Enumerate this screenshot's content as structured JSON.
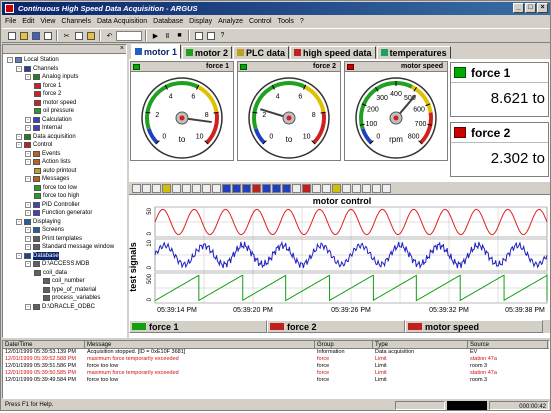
{
  "window": {
    "title": "Continuous High Speed Data Acquisition - ARGUS"
  },
  "menu": [
    "File",
    "Edit",
    "View",
    "Channels",
    "Data Acquisition",
    "Database",
    "Display",
    "Analyze",
    "Control",
    "Tools",
    "?"
  ],
  "tree": [
    {
      "label": "Local Station",
      "depth": 0,
      "icon": "computer-icon",
      "color": "#6080c0"
    },
    {
      "label": "Channels",
      "depth": 1,
      "icon": "folder-icon",
      "color": "#2040a0"
    },
    {
      "label": "Analog inputs",
      "depth": 2,
      "icon": "analog-icon",
      "color": "#208020"
    },
    {
      "label": "force 1",
      "depth": 3,
      "icon": "channel-icon",
      "color": "#d02020"
    },
    {
      "label": "force 2",
      "depth": 3,
      "icon": "channel-icon",
      "color": "#d02020"
    },
    {
      "label": "motor speed",
      "depth": 3,
      "icon": "channel-icon",
      "color": "#d02020"
    },
    {
      "label": "oil pressure",
      "depth": 3,
      "icon": "channel-icon",
      "color": "#20a020"
    },
    {
      "label": "Calculation",
      "depth": 2,
      "icon": "calc-icon",
      "color": "#4040c0"
    },
    {
      "label": "Internal",
      "depth": 2,
      "icon": "internal-icon",
      "color": "#4040c0"
    },
    {
      "label": "Data acquisition",
      "depth": 1,
      "icon": "acquisition-icon",
      "color": "#208020"
    },
    {
      "label": "Control",
      "depth": 1,
      "icon": "control-icon",
      "color": "#c02020"
    },
    {
      "label": "Events",
      "depth": 2,
      "icon": "events-icon",
      "color": "#c06020"
    },
    {
      "label": "Action lists",
      "depth": 2,
      "icon": "action-icon",
      "color": "#c06020"
    },
    {
      "label": "auto printout",
      "depth": 3,
      "icon": "printout-icon",
      "color": "#c0a020"
    },
    {
      "label": "Messages",
      "depth": 2,
      "icon": "messages-icon",
      "color": "#c06020"
    },
    {
      "label": "force too low",
      "depth": 3,
      "icon": "message-icon",
      "color": "#20a020"
    },
    {
      "label": "force too high",
      "depth": 3,
      "icon": "message-icon",
      "color": "#20a020"
    },
    {
      "label": "PID Controller",
      "depth": 2,
      "icon": "pid-icon",
      "color": "#4040c0"
    },
    {
      "label": "Function generator",
      "depth": 2,
      "icon": "function-icon",
      "color": "#4040c0"
    },
    {
      "label": "Displaying",
      "depth": 1,
      "icon": "display-icon",
      "color": "#2060a0"
    },
    {
      "label": "Screens",
      "depth": 2,
      "icon": "screens-icon",
      "color": "#2060a0"
    },
    {
      "label": "Print templates",
      "depth": 2,
      "icon": "print-icon",
      "color": "#606060"
    },
    {
      "label": "Standard message window",
      "depth": 2,
      "icon": "window-icon",
      "color": "#606060"
    },
    {
      "label": "Database",
      "depth": 1,
      "icon": "database-icon",
      "color": "#2040a0",
      "selected": true
    },
    {
      "label": "D:\\ACCESS.MDB",
      "depth": 2,
      "icon": "db-file-icon",
      "color": "#606060"
    },
    {
      "label": "coil_data",
      "depth": 3,
      "icon": "table-icon",
      "color": "#606060"
    },
    {
      "label": "coil_number",
      "depth": 4,
      "icon": "field-icon",
      "color": "#606060"
    },
    {
      "label": "type_of_material",
      "depth": 4,
      "icon": "field-icon",
      "color": "#606060"
    },
    {
      "label": "process_variables",
      "depth": 4,
      "icon": "field-icon",
      "color": "#606060"
    },
    {
      "label": "D:\\ORACLE_ODBC",
      "depth": 2,
      "icon": "db-file-icon",
      "color": "#606060"
    }
  ],
  "tabs": [
    {
      "label": "motor 1",
      "active": true,
      "color": "#2060c0"
    },
    {
      "label": "motor 2",
      "active": false,
      "color": "#20a020"
    },
    {
      "label": "PLC data",
      "active": false,
      "color": "#c0a020"
    },
    {
      "label": "high speed data",
      "active": false,
      "color": "#c02020"
    },
    {
      "label": "temperatures",
      "active": false,
      "color": "#20a060"
    }
  ],
  "gauges": [
    {
      "title": "force 1",
      "unit": "to",
      "min": 0,
      "max": 10,
      "value": 8.621,
      "ticks": [
        0,
        2,
        4,
        6,
        8,
        10
      ],
      "led": "green"
    },
    {
      "title": "force 2",
      "unit": "to",
      "min": 0,
      "max": 10,
      "value": 2.302,
      "ticks": [
        0,
        2,
        4,
        6,
        8,
        10
      ],
      "led": "red"
    },
    {
      "title": "motor speed",
      "unit": "rpm",
      "min": 0,
      "max": 800,
      "value": 520,
      "ticks": [
        0,
        100,
        200,
        300,
        400,
        500,
        600,
        700,
        800
      ],
      "led": "red"
    }
  ],
  "digital": [
    {
      "title": "force 1",
      "value": "8.621",
      "unit": "to",
      "led": "green"
    },
    {
      "title": "force 2",
      "value": "2.302",
      "unit": "to",
      "led": "red"
    }
  ],
  "chart_data": {
    "type": "line",
    "title": "motor control",
    "ylabel": "test signals",
    "xlabel": "",
    "x_ticks": [
      "05:39:14 PM",
      "05:39:20 PM",
      "05:39:26 PM",
      "05:39:32 PM",
      "05:39:38 PM"
    ],
    "y_ticks": [
      "0",
      "50",
      "0",
      "10",
      "0",
      "500"
    ],
    "series": [
      {
        "name": "force 1",
        "color": "#e02020",
        "kind": "sine",
        "cycles": 12.5,
        "ymin": 0,
        "ymax": 10
      },
      {
        "name": "force 2",
        "color": "#2020c0",
        "kind": "noisy-sine",
        "cycles": 10,
        "ymin": 0,
        "ymax": 10
      },
      {
        "name": "motor speed",
        "color": "#10a010",
        "kind": "sawtooth",
        "cycles": 9,
        "ymin": 0,
        "ymax": 500
      }
    ],
    "grid": true
  },
  "log": {
    "headers": [
      "Date/Time",
      "Message",
      "Group",
      "Type",
      "Source"
    ],
    "rows": [
      {
        "time": "12/01/1999 05:39:53.139 PM",
        "message": "Acquisition stopped.  [ID = 0xE10F 3681]",
        "group": "Information",
        "type": "Data acquisition",
        "source": "EV",
        "warn": false
      },
      {
        "time": "12/01/1999 05:39:52.588 PM",
        "message": "maximum force temporarily exceeded",
        "group": "force",
        "type": "Limit",
        "source": "station 47a",
        "warn": true
      },
      {
        "time": "12/01/1999 05:39:51.586 PM",
        "message": "force too low",
        "group": "force",
        "type": "Limit",
        "source": "room 3",
        "warn": false
      },
      {
        "time": "12/01/1999 05:39:50.585 PM",
        "message": "maximum force temporarily exceeded",
        "group": "force",
        "type": "Limit",
        "source": "station 47a",
        "warn": true
      },
      {
        "time": "12/01/1999 05:39:49.584 PM",
        "message": "force too low",
        "group": "force",
        "type": "Limit",
        "source": "room 3",
        "warn": false
      }
    ]
  },
  "status": {
    "help": "Press F1 for Help.",
    "time": "000:00:42"
  }
}
